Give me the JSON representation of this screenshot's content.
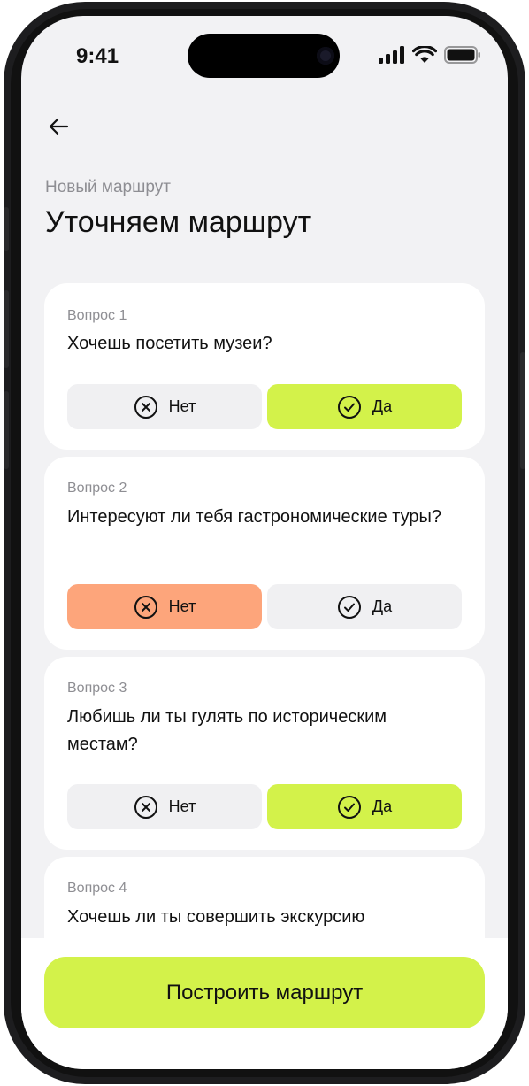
{
  "status_bar": {
    "time": "9:41",
    "icons": [
      "cellular-signal-icon",
      "wifi-icon",
      "battery-icon"
    ]
  },
  "header": {
    "back_icon": "arrow-left-icon",
    "subtitle": "Новый маршрут",
    "title": "Уточняем маршрут"
  },
  "questions": [
    {
      "label": "Вопрос 1",
      "text": "Хочешь посетить музеи?",
      "no_label": "Нет",
      "yes_label": "Да",
      "selected": "yes"
    },
    {
      "label": "Вопрос 2",
      "text": "Интересуют ли тебя гастрономические туры?",
      "no_label": "Нет",
      "yes_label": "Да",
      "selected": "no"
    },
    {
      "label": "Вопрос 3",
      "text": "Любишь ли ты гулять по историческим местам?",
      "no_label": "Нет",
      "yes_label": "Да",
      "selected": "yes"
    },
    {
      "label": "Вопрос 4",
      "text": "Хочешь ли ты совершить экскурсию"
    }
  ],
  "cta": {
    "label": "Построить маршрут"
  },
  "colors": {
    "accent_yes": "#d3f24a",
    "accent_no": "#fda57b",
    "background": "#f2f2f4"
  }
}
